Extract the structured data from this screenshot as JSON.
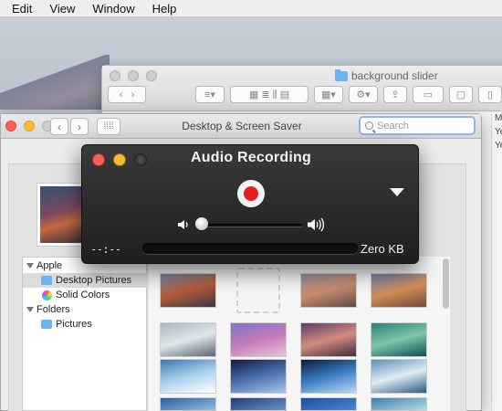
{
  "menubar": {
    "items": [
      "Edit",
      "View",
      "Window",
      "Help"
    ]
  },
  "finder": {
    "title": "background slider",
    "sidebar_snippets": [
      "Ma",
      "Ye",
      "Ye"
    ]
  },
  "prefs_window": {
    "title": "Desktop & Screen Saver",
    "search_placeholder": "Search",
    "sidebar": {
      "groups": [
        {
          "label": "Apple",
          "items": [
            "Desktop Pictures",
            "Solid Colors"
          ]
        },
        {
          "label": "Folders",
          "items": [
            "Pictures"
          ]
        }
      ],
      "selected": "Desktop Pictures"
    },
    "thumbnails": [
      {
        "name": "el-capitan",
        "colors": [
          "#7a8aa3",
          "#b35b3a",
          "#3b3845"
        ]
      },
      {
        "name": "empty-slot",
        "colors": []
      },
      {
        "name": "yosemite-1",
        "colors": [
          "#9b8fa0",
          "#c88b6a",
          "#5d4c4a"
        ]
      },
      {
        "name": "yosemite-2",
        "colors": [
          "#6f86ad",
          "#d48c55",
          "#6e4c3c"
        ]
      },
      {
        "name": "snowy-range",
        "colors": [
          "#aab7c4",
          "#dfe6ea",
          "#5b6570"
        ]
      },
      {
        "name": "purple-hills",
        "colors": [
          "#7d74c8",
          "#c47bb7",
          "#e6c1d9"
        ]
      },
      {
        "name": "desert-dusk",
        "colors": [
          "#5c3c6a",
          "#d18c7c",
          "#3e2d3e"
        ]
      },
      {
        "name": "green-wave",
        "colors": [
          "#2e7f7a",
          "#7cc6a9",
          "#124d56"
        ]
      },
      {
        "name": "blue-wave",
        "colors": [
          "#3b76b1",
          "#a7d2ec",
          "#ffffff"
        ]
      },
      {
        "name": "galaxy",
        "colors": [
          "#0f1a3b",
          "#4a6fb0",
          "#a9c5ea"
        ]
      },
      {
        "name": "earth-horizon",
        "colors": [
          "#0b1b38",
          "#3b7fc4",
          "#bcd7f2"
        ]
      },
      {
        "name": "ice-water",
        "colors": [
          "#5a8fb7",
          "#e0ecf3",
          "#2b5b84"
        ]
      },
      {
        "name": "blue-bottom-1",
        "colors": [
          "#2b5f9c",
          "#8fbde2"
        ]
      },
      {
        "name": "blue-bottom-2",
        "colors": [
          "#203c6e",
          "#6d93cc"
        ]
      },
      {
        "name": "blue-bottom-3",
        "colors": [
          "#1c4f9b",
          "#4d86d2"
        ]
      },
      {
        "name": "blue-bottom-4",
        "colors": [
          "#3f7ea6",
          "#b4dbe9"
        ]
      }
    ]
  },
  "audio_recording": {
    "title": "Audio Recording",
    "elapsed": "--:--",
    "file_size": "Zero KB",
    "volume_level": 0.0
  },
  "colors": {
    "record_red": "#e1231d",
    "accent_blue": "#8ab7ef",
    "traffic_red": "#fc5f57",
    "traffic_yellow": "#fdbc2e"
  }
}
